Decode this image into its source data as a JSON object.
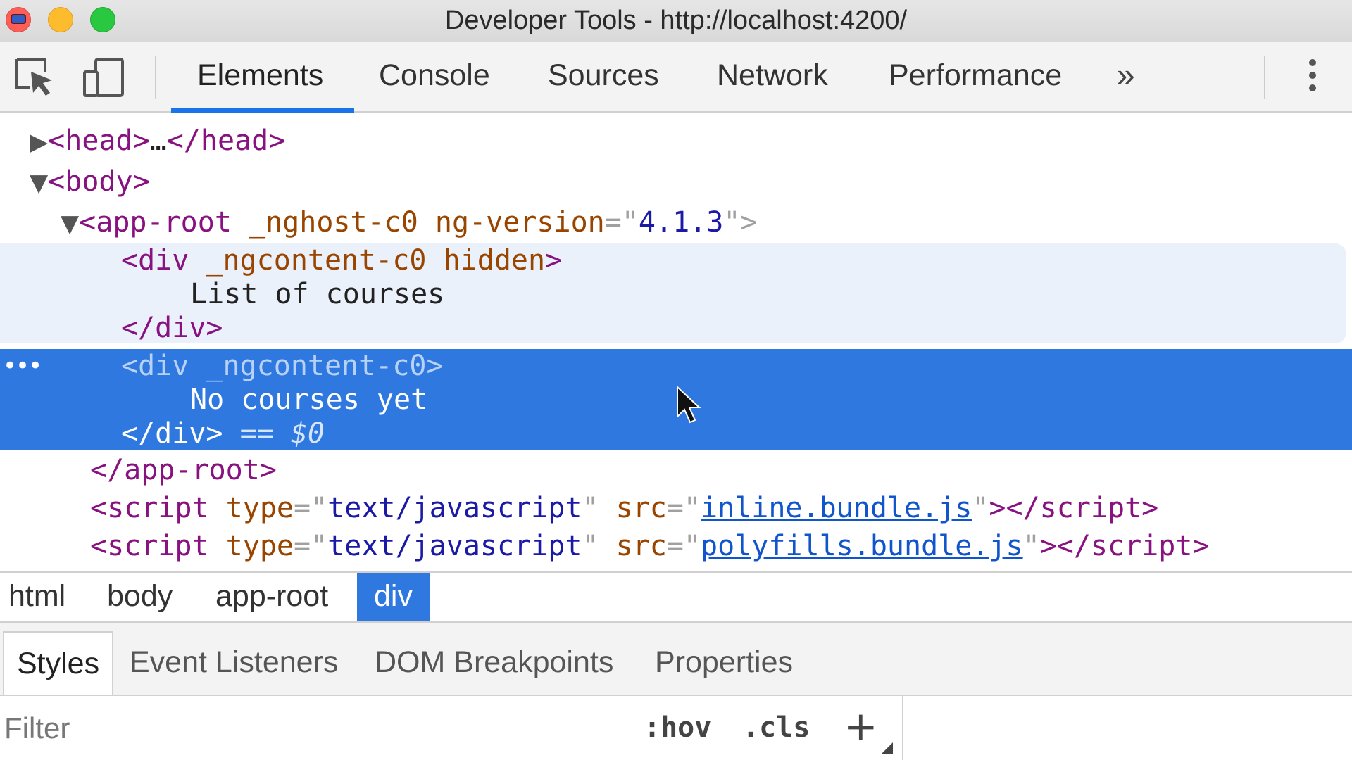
{
  "window": {
    "title": "Developer Tools - http://localhost:4200/"
  },
  "toolbar": {
    "tabs": [
      {
        "label": "Elements",
        "active": true
      },
      {
        "label": "Console"
      },
      {
        "label": "Sources"
      },
      {
        "label": "Network"
      },
      {
        "label": "Performance"
      }
    ],
    "overflow_label": "»",
    "icons": [
      "inspect-element-icon",
      "device-toolbar-icon",
      "more-options-icon"
    ],
    "accent_color": "#1a73e8"
  },
  "tree": {
    "head": {
      "open": "<head>",
      "ellipsis": "…",
      "close": "</head>"
    },
    "body_open": "<body>",
    "app_root": {
      "tag": "<app-root",
      "attr1": "_nghost-c0",
      "attr2": "ng-version",
      "eq": "=\"",
      "value": "4.1.3",
      "end": "\">"
    },
    "div_hidden": {
      "open_tag": "<div",
      "attr1": "_ngcontent-c0",
      "attr2": "hidden",
      "gt": ">",
      "text": "List of courses",
      "close": "</div>"
    },
    "div_selected": {
      "open_tag": "<div",
      "attr1": "_ngcontent-c0",
      "gt": ">",
      "text": "No courses yet",
      "close": "</div>",
      "marker": "== $0"
    },
    "app_root_close": "</app-root>",
    "scripts": [
      {
        "type_value": "text/javascript",
        "src": "inline.bundle.js"
      },
      {
        "type_value": "text/javascript",
        "src": "polyfills.bundle.js"
      }
    ],
    "selected_color": "#2f78e0",
    "hover_color": "#eaf1fb"
  },
  "breadcrumbs": [
    {
      "label": "html"
    },
    {
      "label": "body"
    },
    {
      "label": "app-root"
    },
    {
      "label": "div",
      "active": true
    }
  ],
  "sidebar_tabs": [
    {
      "label": "Styles",
      "active": true
    },
    {
      "label": "Event Listeners"
    },
    {
      "label": "DOM Breakpoints"
    },
    {
      "label": "Properties"
    }
  ],
  "styles_filter": {
    "placeholder": "Filter",
    "hov_label": ":hov",
    "cls_label": ".cls",
    "add_label": "+"
  }
}
